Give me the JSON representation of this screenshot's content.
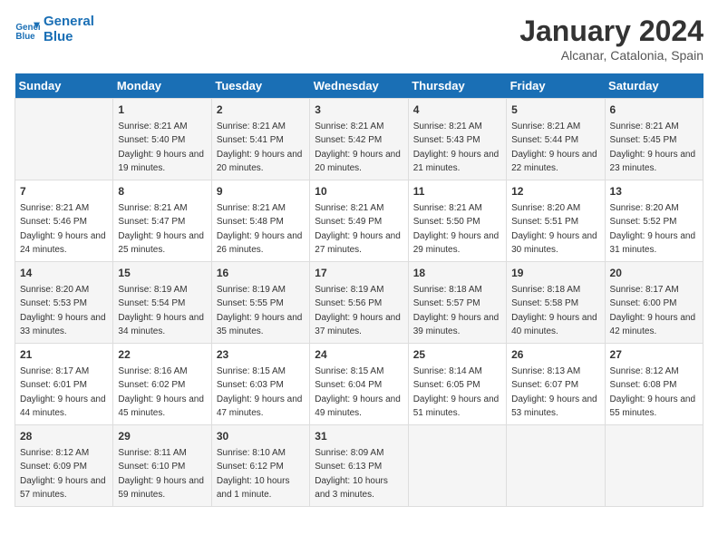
{
  "logo": {
    "line1": "General",
    "line2": "Blue"
  },
  "header": {
    "month": "January 2024",
    "location": "Alcanar, Catalonia, Spain"
  },
  "weekdays": [
    "Sunday",
    "Monday",
    "Tuesday",
    "Wednesday",
    "Thursday",
    "Friday",
    "Saturday"
  ],
  "weeks": [
    [
      {
        "day": "",
        "sunrise": "",
        "sunset": "",
        "daylight": ""
      },
      {
        "day": "1",
        "sunrise": "8:21 AM",
        "sunset": "5:40 PM",
        "daylight": "9 hours and 19 minutes."
      },
      {
        "day": "2",
        "sunrise": "8:21 AM",
        "sunset": "5:41 PM",
        "daylight": "9 hours and 20 minutes."
      },
      {
        "day": "3",
        "sunrise": "8:21 AM",
        "sunset": "5:42 PM",
        "daylight": "9 hours and 20 minutes."
      },
      {
        "day": "4",
        "sunrise": "8:21 AM",
        "sunset": "5:43 PM",
        "daylight": "9 hours and 21 minutes."
      },
      {
        "day": "5",
        "sunrise": "8:21 AM",
        "sunset": "5:44 PM",
        "daylight": "9 hours and 22 minutes."
      },
      {
        "day": "6",
        "sunrise": "8:21 AM",
        "sunset": "5:45 PM",
        "daylight": "9 hours and 23 minutes."
      }
    ],
    [
      {
        "day": "7",
        "sunrise": "8:21 AM",
        "sunset": "5:46 PM",
        "daylight": "9 hours and 24 minutes."
      },
      {
        "day": "8",
        "sunrise": "8:21 AM",
        "sunset": "5:47 PM",
        "daylight": "9 hours and 25 minutes."
      },
      {
        "day": "9",
        "sunrise": "8:21 AM",
        "sunset": "5:48 PM",
        "daylight": "9 hours and 26 minutes."
      },
      {
        "day": "10",
        "sunrise": "8:21 AM",
        "sunset": "5:49 PM",
        "daylight": "9 hours and 27 minutes."
      },
      {
        "day": "11",
        "sunrise": "8:21 AM",
        "sunset": "5:50 PM",
        "daylight": "9 hours and 29 minutes."
      },
      {
        "day": "12",
        "sunrise": "8:20 AM",
        "sunset": "5:51 PM",
        "daylight": "9 hours and 30 minutes."
      },
      {
        "day": "13",
        "sunrise": "8:20 AM",
        "sunset": "5:52 PM",
        "daylight": "9 hours and 31 minutes."
      }
    ],
    [
      {
        "day": "14",
        "sunrise": "8:20 AM",
        "sunset": "5:53 PM",
        "daylight": "9 hours and 33 minutes."
      },
      {
        "day": "15",
        "sunrise": "8:19 AM",
        "sunset": "5:54 PM",
        "daylight": "9 hours and 34 minutes."
      },
      {
        "day": "16",
        "sunrise": "8:19 AM",
        "sunset": "5:55 PM",
        "daylight": "9 hours and 35 minutes."
      },
      {
        "day": "17",
        "sunrise": "8:19 AM",
        "sunset": "5:56 PM",
        "daylight": "9 hours and 37 minutes."
      },
      {
        "day": "18",
        "sunrise": "8:18 AM",
        "sunset": "5:57 PM",
        "daylight": "9 hours and 39 minutes."
      },
      {
        "day": "19",
        "sunrise": "8:18 AM",
        "sunset": "5:58 PM",
        "daylight": "9 hours and 40 minutes."
      },
      {
        "day": "20",
        "sunrise": "8:17 AM",
        "sunset": "6:00 PM",
        "daylight": "9 hours and 42 minutes."
      }
    ],
    [
      {
        "day": "21",
        "sunrise": "8:17 AM",
        "sunset": "6:01 PM",
        "daylight": "9 hours and 44 minutes."
      },
      {
        "day": "22",
        "sunrise": "8:16 AM",
        "sunset": "6:02 PM",
        "daylight": "9 hours and 45 minutes."
      },
      {
        "day": "23",
        "sunrise": "8:15 AM",
        "sunset": "6:03 PM",
        "daylight": "9 hours and 47 minutes."
      },
      {
        "day": "24",
        "sunrise": "8:15 AM",
        "sunset": "6:04 PM",
        "daylight": "9 hours and 49 minutes."
      },
      {
        "day": "25",
        "sunrise": "8:14 AM",
        "sunset": "6:05 PM",
        "daylight": "9 hours and 51 minutes."
      },
      {
        "day": "26",
        "sunrise": "8:13 AM",
        "sunset": "6:07 PM",
        "daylight": "9 hours and 53 minutes."
      },
      {
        "day": "27",
        "sunrise": "8:12 AM",
        "sunset": "6:08 PM",
        "daylight": "9 hours and 55 minutes."
      }
    ],
    [
      {
        "day": "28",
        "sunrise": "8:12 AM",
        "sunset": "6:09 PM",
        "daylight": "9 hours and 57 minutes."
      },
      {
        "day": "29",
        "sunrise": "8:11 AM",
        "sunset": "6:10 PM",
        "daylight": "9 hours and 59 minutes."
      },
      {
        "day": "30",
        "sunrise": "8:10 AM",
        "sunset": "6:12 PM",
        "daylight": "10 hours and 1 minute."
      },
      {
        "day": "31",
        "sunrise": "8:09 AM",
        "sunset": "6:13 PM",
        "daylight": "10 hours and 3 minutes."
      },
      {
        "day": "",
        "sunrise": "",
        "sunset": "",
        "daylight": ""
      },
      {
        "day": "",
        "sunrise": "",
        "sunset": "",
        "daylight": ""
      },
      {
        "day": "",
        "sunrise": "",
        "sunset": "",
        "daylight": ""
      }
    ]
  ]
}
